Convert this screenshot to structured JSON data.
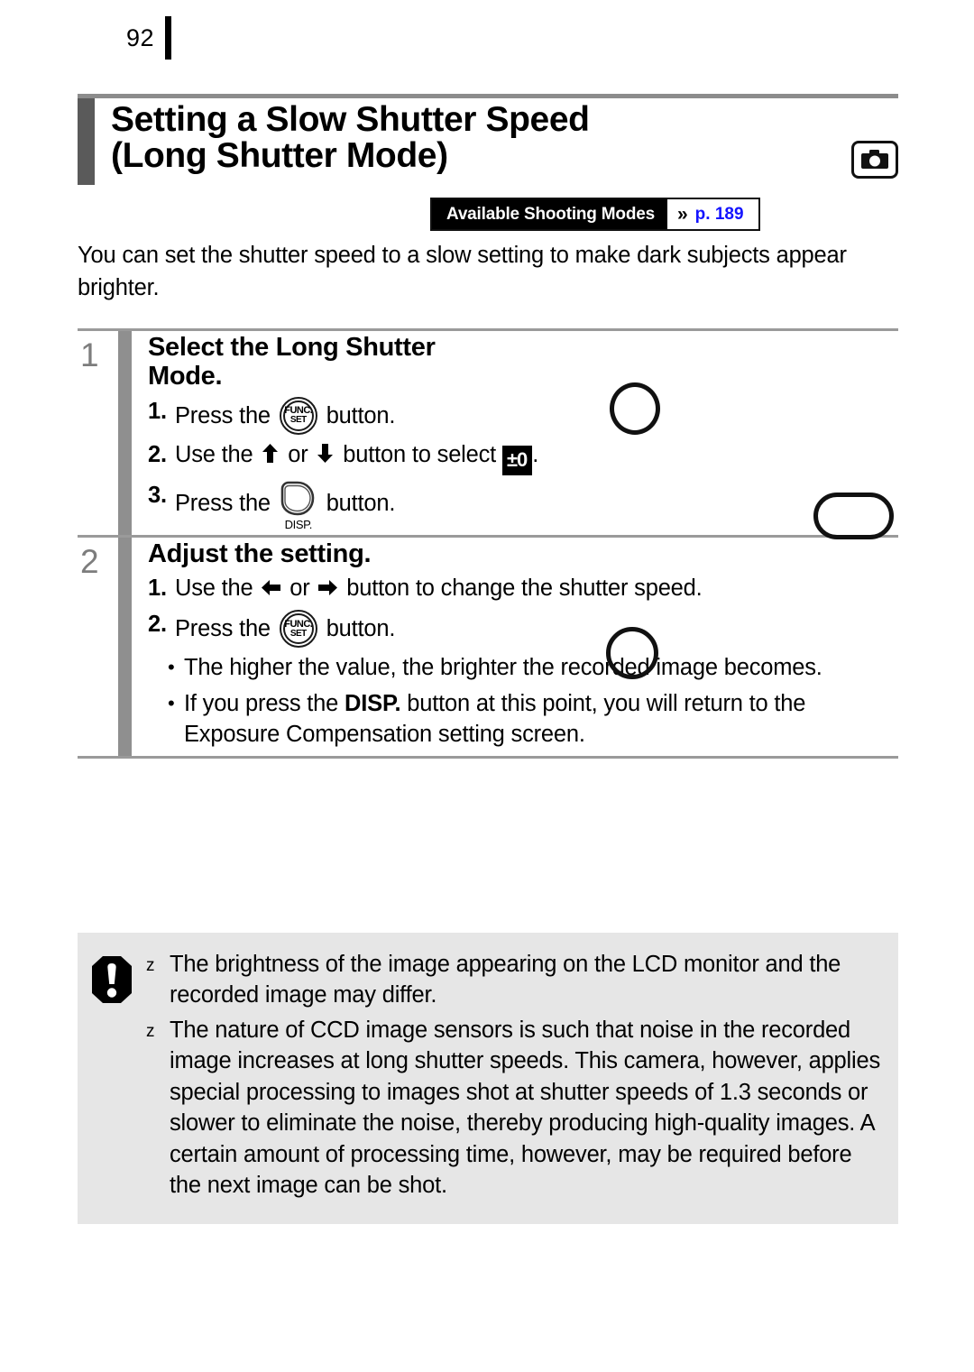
{
  "page": {
    "number": "92"
  },
  "title": {
    "line1": "Setting a Slow Shutter Speed",
    "line2": "(Long Shutter Mode)",
    "full": "Setting a Slow Shutter Speed\n(Long Shutter Mode)",
    "mode_icon": "camera-icon"
  },
  "modes_badge": {
    "label": "Available Shooting Modes",
    "chevron": "»",
    "page_ref": "p. 189",
    "page_ref_color": "#1414ff"
  },
  "intro": "You can set the shutter speed to a slow setting to make dark subjects appear brighter.",
  "steps": [
    {
      "number": "1",
      "heading": "Select the Long Shutter\nMode.",
      "substeps": [
        {
          "n": "1.",
          "pre": "Press the ",
          "icon": "func-set-button-icon",
          "post": " button."
        },
        {
          "n": "2.",
          "pre": "Use the ",
          "icon": "up-arrow-icon",
          "mid": " or ",
          "icon2": "down-arrow-icon",
          "post": " button to select ",
          "badge": "±0",
          "tail": "."
        },
        {
          "n": "3.",
          "pre": "Press the ",
          "icon": "disp-button-icon",
          "post": " button."
        }
      ]
    },
    {
      "number": "2",
      "heading": "Adjust the setting.",
      "substeps": [
        {
          "n": "1.",
          "pre": "Use the ",
          "icon": "left-arrow-icon",
          "mid": " or ",
          "icon2": "right-arrow-icon",
          "post": " button to change the shutter speed."
        },
        {
          "n": "2.",
          "pre": "Press the ",
          "icon": "func-set-button-icon",
          "post": " button."
        }
      ],
      "bullets": [
        {
          "text": "The higher the value, the brighter the recorded image becomes."
        },
        {
          "pre": "If you press the ",
          "bold": "DISP.",
          "post": " button at this point, you will return to the Exposure Compensation setting screen."
        }
      ]
    }
  ],
  "note_box": {
    "icon": "warning-exclamation-icon",
    "bullet_glyph": "z",
    "items": [
      "The brightness of the image appearing on the LCD monitor and the recorded image may differ.",
      "The nature of CCD image sensors is such that noise in the recorded image increases at long shutter speeds. This camera, however, applies special processing to images shot at shutter speeds of 1.3 seconds or slower to eliminate the noise, thereby producing high-quality images. A certain amount of processing time, however, may be required before the next image can be shot."
    ]
  },
  "func_set_icon": {
    "line1": "FUNC.",
    "line2": "SET"
  },
  "disp_icon": {
    "label": "DISP."
  },
  "arrows": {
    "up": "↑",
    "down": "↓",
    "left": "←",
    "right": "→"
  },
  "colors": {
    "title_bar": "#5a5a5a",
    "step_bar": "#8f8f8f",
    "step_num": "#7d7d7d",
    "rule": "#9a9a9a",
    "note_bg": "#e6e6e6",
    "link_blue": "#1414ff"
  }
}
